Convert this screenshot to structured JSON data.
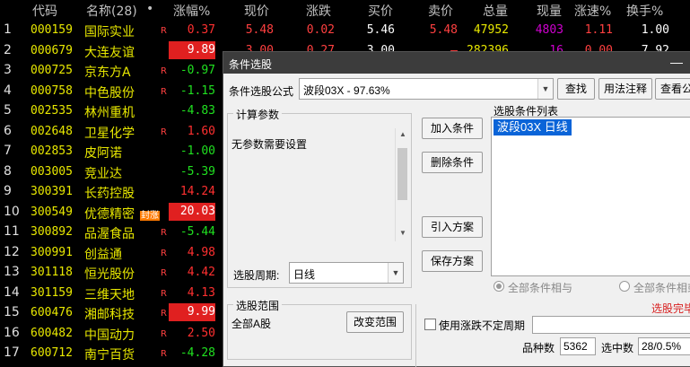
{
  "table": {
    "headers": {
      "code": "代码",
      "name": "名称(28)",
      "dot": "•",
      "pct": "涨幅%",
      "price": "现价",
      "chg": "涨跌",
      "bid": "买价",
      "ask": "卖价",
      "vol": "总量",
      "cur": "现量",
      "speed": "涨速%",
      "turn": "换手%"
    },
    "rows": [
      {
        "idx": "1",
        "code": "000159",
        "name": "国际实业",
        "r": "R",
        "pct": "0.37",
        "price": "5.48",
        "chg": "0.02",
        "bid": "5.46",
        "ask": "5.48",
        "vol": "47952",
        "cur": "4803",
        "speed": "1.11",
        "turn": "1.00"
      },
      {
        "idx": "2",
        "code": "000679",
        "name": "大连友谊",
        "r": "",
        "pct": "9.89",
        "price": "3.00",
        "chg": "0.27",
        "bid": "3.00",
        "ask": "—",
        "vol": "282396",
        "cur": "16",
        "speed": "0.00",
        "turn": "7.92"
      },
      {
        "idx": "3",
        "code": "000725",
        "name": "京东方A",
        "r": "R",
        "pct": "-0.97"
      },
      {
        "idx": "4",
        "code": "000758",
        "name": "中色股份",
        "r": "R",
        "pct": "-1.15"
      },
      {
        "idx": "5",
        "code": "002535",
        "name": "林州重机",
        "r": "",
        "pct": "-4.83"
      },
      {
        "idx": "6",
        "code": "002648",
        "name": "卫星化学",
        "r": "R",
        "pct": "1.60"
      },
      {
        "idx": "7",
        "code": "002853",
        "name": "皮阿诺",
        "r": "",
        "pct": "-1.00"
      },
      {
        "idx": "8",
        "code": "003005",
        "name": "竞业达",
        "r": "",
        "pct": "-5.39"
      },
      {
        "idx": "9",
        "code": "300391",
        "name": "长药控股",
        "r": "",
        "pct": "14.24"
      },
      {
        "idx": "10",
        "code": "300549",
        "name": "优德精密",
        "r": "",
        "pct": "20.03",
        "tag": "封涨"
      },
      {
        "idx": "11",
        "code": "300892",
        "name": "品渥食品",
        "r": "R",
        "pct": "-5.44"
      },
      {
        "idx": "12",
        "code": "300991",
        "name": "创益通",
        "r": "R",
        "pct": "4.98"
      },
      {
        "idx": "13",
        "code": "301118",
        "name": "恒光股份",
        "r": "R",
        "pct": "4.42"
      },
      {
        "idx": "14",
        "code": "301159",
        "name": "三维天地",
        "r": "R",
        "pct": "4.13"
      },
      {
        "idx": "15",
        "code": "600476",
        "name": "湘邮科技",
        "r": "R",
        "pct": "9.99"
      },
      {
        "idx": "16",
        "code": "600482",
        "name": "中国动力",
        "r": "R",
        "pct": "2.50"
      },
      {
        "idx": "17",
        "code": "600712",
        "name": "南宁百货",
        "r": "R",
        "pct": "-4.28"
      }
    ]
  },
  "dialog": {
    "title": "条件选股",
    "formula_label": "条件选股公式",
    "formula_value": "波段03X  -  97.63%",
    "btn_find": "查找",
    "btn_usage": "用法注释",
    "btn_view": "查看公",
    "calc_params_title": "计算参数",
    "calc_params_text": "无参数需要设置",
    "btn_add": "加入条件",
    "btn_delete": "删除条件",
    "btn_import": "引入方案",
    "btn_save": "保存方案",
    "cond_list_title": "选股条件列表",
    "cond_list_item": "波段03X  日线",
    "period_label": "选股周期:",
    "period_value": "日线",
    "radio_and": "全部条件相与",
    "radio_or": "全部条件相或",
    "select_done": "选股完毕",
    "scope_title": "选股范围",
    "scope_value": "全部A股",
    "btn_change_scope": "改变范围",
    "use_period_label": "使用涨跌不定周期",
    "count_label": "品种数",
    "count_value": "5362",
    "selected_label": "选中数",
    "selected_value": "28/0.5%"
  }
}
